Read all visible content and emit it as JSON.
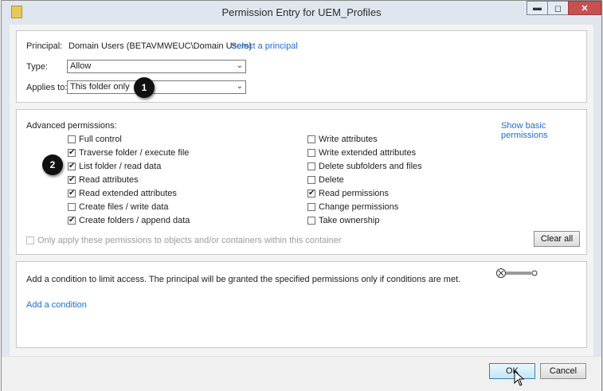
{
  "window": {
    "title": "Permission Entry for UEM_Profiles",
    "minimize_glyph": "▬",
    "maximize_glyph": "◻",
    "close_glyph": "✕"
  },
  "principal": {
    "label": "Principal:",
    "value": "Domain Users (BETAVMWEUC\\Domain Users)",
    "select_link": "Select a principal"
  },
  "type": {
    "label": "Type:",
    "value": "Allow"
  },
  "applies_to": {
    "label": "Applies to:",
    "value": "This folder only"
  },
  "badges": {
    "one": "1",
    "two": "2"
  },
  "advanced": {
    "label": "Advanced permissions:",
    "show_basic_link": "Show basic permissions",
    "left": [
      {
        "label": "Full control",
        "checked": false
      },
      {
        "label": "Traverse folder / execute file",
        "checked": true
      },
      {
        "label": "List folder / read data",
        "checked": true
      },
      {
        "label": "Read attributes",
        "checked": true
      },
      {
        "label": "Read extended attributes",
        "checked": true
      },
      {
        "label": "Create files / write data",
        "checked": false
      },
      {
        "label": "Create folders / append data",
        "checked": true
      }
    ],
    "right": [
      {
        "label": "Write attributes",
        "checked": false
      },
      {
        "label": "Write extended attributes",
        "checked": false
      },
      {
        "label": "Delete subfolders and files",
        "checked": false
      },
      {
        "label": "Delete",
        "checked": false
      },
      {
        "label": "Read permissions",
        "checked": true
      },
      {
        "label": "Change permissions",
        "checked": false
      },
      {
        "label": "Take ownership",
        "checked": false
      }
    ],
    "only_apply_label": "Only apply these permissions to objects and/or containers within this container",
    "clear_all": "Clear all"
  },
  "condition": {
    "text": "Add a condition to limit access. The principal will be granted the specified permissions only if conditions are met.",
    "add_link": "Add a condition"
  },
  "footer": {
    "ok": "OK",
    "cancel": "Cancel"
  }
}
